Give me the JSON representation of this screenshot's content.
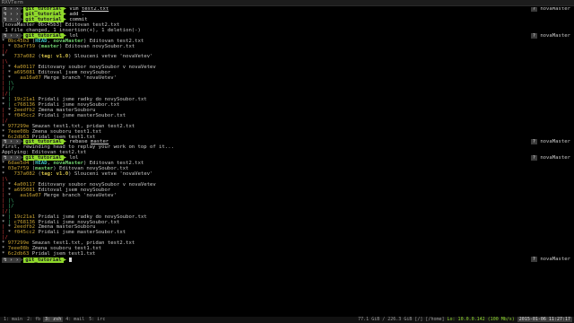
{
  "window": {
    "title": "RXVTerm"
  },
  "prompt": {
    "os_glyph": "↯",
    "dir": "git_tutorial",
    "sep": "›",
    "arrow": "▶"
  },
  "right_prompt": {
    "q": "?",
    "branch": "novaMaster"
  },
  "lines": [
    {
      "kind": "prompt",
      "cmd": "vim test2.txt",
      "cmd_underline": "test2.txt",
      "right": true
    },
    {
      "kind": "prompt",
      "cmd": "add .",
      "right": false
    },
    {
      "kind": "prompt",
      "cmd": "commit",
      "right": false
    },
    {
      "kind": "out",
      "text": "[novaMaster 0bc45b3] Editovan test2.txt"
    },
    {
      "kind": "out",
      "text": " 1 file changed, 1 insertion(+), 1 deletion(-)"
    },
    {
      "kind": "prompt",
      "cmd": "lol",
      "right": true
    },
    {
      "kind": "log",
      "graph": "* ",
      "hash": "0bc45b3",
      "refs": [
        {
          "t": "head",
          "v": "HEAD"
        },
        {
          "t": "branch",
          "v": "novaMaster"
        }
      ],
      "msg": "Editovan test2.txt"
    },
    {
      "kind": "log",
      "graph": "| * ",
      "hash": "03e7f59",
      "refs": [
        {
          "t": "branch",
          "v": "master"
        }
      ],
      "msg": "Editovan novySoubor.txt"
    },
    {
      "kind": "graph",
      "graph": "|/"
    },
    {
      "kind": "log",
      "graph": "*   ",
      "hash": "737a082",
      "refs": [
        {
          "t": "tag",
          "v": "tag: v1.0"
        }
      ],
      "msg": "Slouceni vetve 'novaVetev'"
    },
    {
      "kind": "graph",
      "graph": "|\\"
    },
    {
      "kind": "log",
      "graph": "| * ",
      "hash": "4a00117",
      "refs": [],
      "msg": "Editovany soubor novySoubor v novaVetev"
    },
    {
      "kind": "log",
      "graph": "| * ",
      "hash": "a695081",
      "refs": [],
      "msg": "Editoval jsem novySoubor"
    },
    {
      "kind": "log",
      "graph": "| *   ",
      "hash": "aa16a07",
      "refs": [],
      "msg": "Merge branch 'novaVetev'"
    },
    {
      "kind": "graph",
      "graph": "| |\\"
    },
    {
      "kind": "graph",
      "graph": "| |/"
    },
    {
      "kind": "graph",
      "graph": "|/|"
    },
    {
      "kind": "log",
      "graph": "* | ",
      "hash": "19c21a1",
      "refs": [],
      "msg": "Pridali jsme radky do novySoubor.txt"
    },
    {
      "kind": "log",
      "graph": "* | ",
      "hash": "c768136",
      "refs": [],
      "msg": "Pridali jsme novySoubor.txt"
    },
    {
      "kind": "log",
      "graph": "| * ",
      "hash": "2eedfb2",
      "refs": [],
      "msg": "Zmena masterSouboru"
    },
    {
      "kind": "log",
      "graph": "| * ",
      "hash": "f045cc2",
      "refs": [],
      "msg": "Pridali jsme masterSoubor.txt"
    },
    {
      "kind": "graph",
      "graph": "|/"
    },
    {
      "kind": "log",
      "graph": "* ",
      "hash": "977299e",
      "refs": [],
      "msg": "Smazan test1.txt, pridan test2.txt"
    },
    {
      "kind": "log",
      "graph": "* ",
      "hash": "7eee08b",
      "refs": [],
      "msg": "Zmena souboru test1.txt"
    },
    {
      "kind": "log",
      "graph": "* ",
      "hash": "6c2db63",
      "refs": [],
      "msg": "Pridal jsem test1.txt"
    },
    {
      "kind": "prompt",
      "cmd": "rebase master",
      "cmd_underline": "master",
      "right": true
    },
    {
      "kind": "out",
      "text": "First, rewinding head to replay your work on top of it..."
    },
    {
      "kind": "out",
      "text": "Applying: Editovan test2.txt"
    },
    {
      "kind": "prompt",
      "cmd": "lol",
      "right": true
    },
    {
      "kind": "log",
      "graph": "* ",
      "hash": "6dae5d4",
      "refs": [
        {
          "t": "head",
          "v": "HEAD"
        },
        {
          "t": "branch",
          "v": "novaMaster"
        }
      ],
      "msg": "Editovan test2.txt"
    },
    {
      "kind": "log",
      "graph": "* ",
      "hash": "03e7f59",
      "refs": [
        {
          "t": "branch",
          "v": "master"
        }
      ],
      "msg": "Editovan novySoubor.txt"
    },
    {
      "kind": "log",
      "graph": "*   ",
      "hash": "737a082",
      "refs": [
        {
          "t": "tag",
          "v": "tag: v1.0"
        }
      ],
      "msg": "Slouceni vetve 'novaVetev'"
    },
    {
      "kind": "graph",
      "graph": "|\\"
    },
    {
      "kind": "log",
      "graph": "| * ",
      "hash": "4a00117",
      "refs": [],
      "msg": "Editovany soubor novySoubor v novaVetev"
    },
    {
      "kind": "log",
      "graph": "| * ",
      "hash": "a695081",
      "refs": [],
      "msg": "Editoval jsem novySoubor"
    },
    {
      "kind": "log",
      "graph": "| *   ",
      "hash": "aa16a07",
      "refs": [],
      "msg": "Merge branch 'novaVetev'"
    },
    {
      "kind": "graph",
      "graph": "| |\\"
    },
    {
      "kind": "graph",
      "graph": "| |/"
    },
    {
      "kind": "graph",
      "graph": "|/|"
    },
    {
      "kind": "log",
      "graph": "* | ",
      "hash": "19c21a1",
      "refs": [],
      "msg": "Pridali jsme radky do novySoubor.txt"
    },
    {
      "kind": "log",
      "graph": "* | ",
      "hash": "c768136",
      "refs": [],
      "msg": "Pridali jsme novySoubor.txt"
    },
    {
      "kind": "log",
      "graph": "| * ",
      "hash": "2eedfb2",
      "refs": [],
      "msg": "Zmena masterSouboru"
    },
    {
      "kind": "log",
      "graph": "| * ",
      "hash": "f045cc2",
      "refs": [],
      "msg": "Pridali jsme masterSoubor.txt"
    },
    {
      "kind": "graph",
      "graph": "|/"
    },
    {
      "kind": "log",
      "graph": "* ",
      "hash": "977299e",
      "refs": [],
      "msg": "Smazan test1.txt, pridan test2.txt"
    },
    {
      "kind": "log",
      "graph": "* ",
      "hash": "7eee08b",
      "refs": [],
      "msg": "Zmena souboru test1.txt"
    },
    {
      "kind": "log",
      "graph": "* ",
      "hash": "6c2db63",
      "refs": [],
      "msg": "Pridal jsem test1.txt"
    },
    {
      "kind": "prompt",
      "cmd": "",
      "cursor": true,
      "right": true
    }
  ],
  "statusbar": {
    "tabs": [
      {
        "label": "1: main",
        "active": false
      },
      {
        "label": "2: fb",
        "active": false
      },
      {
        "label": "3: zsh",
        "active": true
      },
      {
        "label": "4: mail",
        "active": false
      },
      {
        "label": "5: irc",
        "active": false
      }
    ],
    "disk_root": "77.1 GiB / 226.3 GiB [/]",
    "disk_home": "[/home]",
    "net": "Lo: 10.0.0.142 (100 Mb/s)",
    "datetime": "2015-01-06 11:27:17"
  },
  "colors": {
    "dir_bg": "#8fd82b",
    "os_bg": "#3b3b3b",
    "hash": "#c8a232",
    "head": "#3fc6c6",
    "branch": "#6fcf6f",
    "tag": "#d4c04a"
  }
}
